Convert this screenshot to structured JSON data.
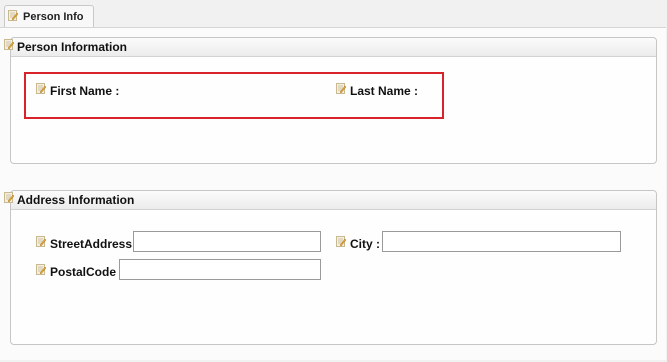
{
  "tab": {
    "label": "Person Info"
  },
  "person_info": {
    "title": "Person Information",
    "first_name_label": "First Name :",
    "last_name_label": "Last Name :"
  },
  "address_info": {
    "title": "Address Information",
    "street_label": "StreetAddress :",
    "street_value": "",
    "city_label": "City :",
    "city_value": "",
    "postal_label": "PostalCode :",
    "postal_value": ""
  },
  "colors": {
    "highlight": "#d9232a"
  },
  "icons": {
    "field_icon": "edit-note-icon"
  }
}
